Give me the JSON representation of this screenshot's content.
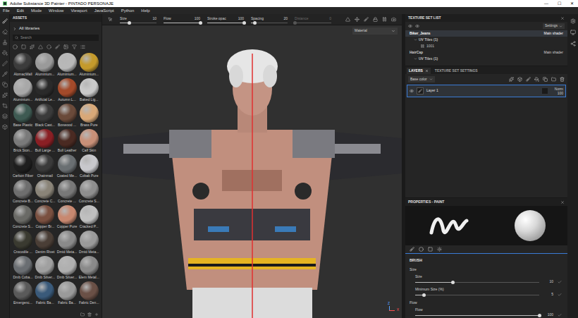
{
  "window": {
    "title": "Adobe Substance 3D Painter - PINTADO PERSONAJE",
    "controls": [
      "—",
      "☐",
      "✕"
    ]
  },
  "menu": [
    "File",
    "Edit",
    "Mode",
    "Window",
    "Viewport",
    "JavaScript",
    "Python",
    "Help"
  ],
  "tool_options": [
    {
      "label": "Size",
      "value": "10",
      "level": 0.25,
      "disabled": false
    },
    {
      "label": "Flow",
      "value": "100",
      "level": 1,
      "disabled": false
    },
    {
      "label": "Stroke opac",
      "value": "100",
      "level": 1,
      "disabled": false
    },
    {
      "label": "Spacing",
      "value": "20",
      "level": 0.1,
      "disabled": false
    },
    {
      "label": "Distance",
      "value": "0",
      "level": 0,
      "disabled": true
    }
  ],
  "assets": {
    "title": "ASSETS",
    "library": "All libraries",
    "search_placeholder": "Search",
    "items": [
      {
        "name": "AlomacWall",
        "color": "#3c3c3c"
      },
      {
        "name": "Aluminium...",
        "color": "#9a9a9a"
      },
      {
        "name": "Aluminium...",
        "color": "#b8b8b8"
      },
      {
        "name": "Aluminium...",
        "color": "#c49a2c"
      },
      {
        "name": "Aluminium...",
        "color": "#a8a8a8"
      },
      {
        "name": "Artificial Le...",
        "color": "#2a2a2a"
      },
      {
        "name": "Autumn L...",
        "color": "#a44a2a"
      },
      {
        "name": "Baked Lig...",
        "color": "#c9c9c9"
      },
      {
        "name": "Base Plastic",
        "color": "#3e5a52"
      },
      {
        "name": "Black Cast...",
        "color": "#3a3a3a"
      },
      {
        "name": "Boxwood ...",
        "color": "#6a4a3a"
      },
      {
        "name": "Brass Pure",
        "color": "#d8a878"
      },
      {
        "name": "Brick Ston...",
        "color": "#7a7a7a"
      },
      {
        "name": "Bull Large ...",
        "color": "#8a1f24"
      },
      {
        "name": "Bull Leather",
        "color": "#4a2a22"
      },
      {
        "name": "Calf Skin",
        "color": "#c89078"
      },
      {
        "name": "Carbon Fiber",
        "color": "#1e1e1e"
      },
      {
        "name": "Chainmail",
        "color": "#3a3a3a"
      },
      {
        "name": "Coated Me...",
        "color": "#6a6f72"
      },
      {
        "name": "Cobalt Pure",
        "color": "#c8c8cc"
      },
      {
        "name": "Concrete B...",
        "color": "#6e6e6e"
      },
      {
        "name": "Concrete C...",
        "color": "#8a8478"
      },
      {
        "name": "Concrete ...",
        "color": "#787878"
      },
      {
        "name": "Concrete S...",
        "color": "#8e8e8e"
      },
      {
        "name": "Concrete S...",
        "color": "#6a6a66"
      },
      {
        "name": "Copper Br...",
        "color": "#7a5040"
      },
      {
        "name": "Copper Pure",
        "color": "#c88870"
      },
      {
        "name": "Cracked P...",
        "color": "#c0c0c0"
      },
      {
        "name": "Crocodile ...",
        "color": "#3a3a30"
      },
      {
        "name": "Denim Rivet",
        "color": "#4a3e36"
      },
      {
        "name": "Dmid Meta...",
        "color": "#8a8a8a"
      },
      {
        "name": "Dmid Meta...",
        "color": "#9a9a9a"
      },
      {
        "name": "Dmb Coba...",
        "color": "#6a6e72"
      },
      {
        "name": "Dmb Silver...",
        "color": "#a0a0a0"
      },
      {
        "name": "Dmb Silver...",
        "color": "#b0b0b0"
      },
      {
        "name": "Elem Metal...",
        "color": "#8a8a8a"
      },
      {
        "name": "Emergenc...",
        "color": "#5a5a5a"
      },
      {
        "name": "Fabric Ba...",
        "color": "#3a5a7a"
      },
      {
        "name": "Fabric Ba...",
        "color": "#9a9a9a"
      },
      {
        "name": "Fabric Den...",
        "color": "#6a5046"
      }
    ]
  },
  "viewport": {
    "mode": "Material",
    "axes": [
      "Z",
      "X"
    ]
  },
  "texture_set_list": {
    "title": "TEXTURE SET LIST",
    "settings": "Settings",
    "sets": [
      {
        "name": "Biker_Jeans",
        "shader": "Main shader",
        "selected": true,
        "uv_label": "UV Tiles (1)",
        "tiles": [
          "1001"
        ]
      },
      {
        "name": "HairCap",
        "shader": "Main shader",
        "selected": false,
        "uv_label": "UV Tiles (1)",
        "tiles": []
      }
    ]
  },
  "layers": {
    "tabs": [
      {
        "label": "LAYERS",
        "selected": true
      },
      {
        "label": "TEXTURE SET SETTINGS",
        "selected": false
      }
    ],
    "channel": "Base color",
    "items": [
      {
        "name": "Layer 1",
        "blend": "Norm",
        "opacity": "100",
        "visible": true,
        "selected": true
      }
    ]
  },
  "properties": {
    "title": "PROPERTIES - PAINT",
    "section": "BRUSH",
    "params": [
      {
        "kind": "header",
        "label": "Size"
      },
      {
        "kind": "slider",
        "label": "Size",
        "value": "10",
        "level": 0.3
      },
      {
        "kind": "slider",
        "label": "Minimum Size (%)",
        "value": "5",
        "level": 0.07
      },
      {
        "kind": "header",
        "label": "Flow"
      },
      {
        "kind": "slider",
        "label": "Flow",
        "value": "100",
        "level": 1
      }
    ]
  }
}
